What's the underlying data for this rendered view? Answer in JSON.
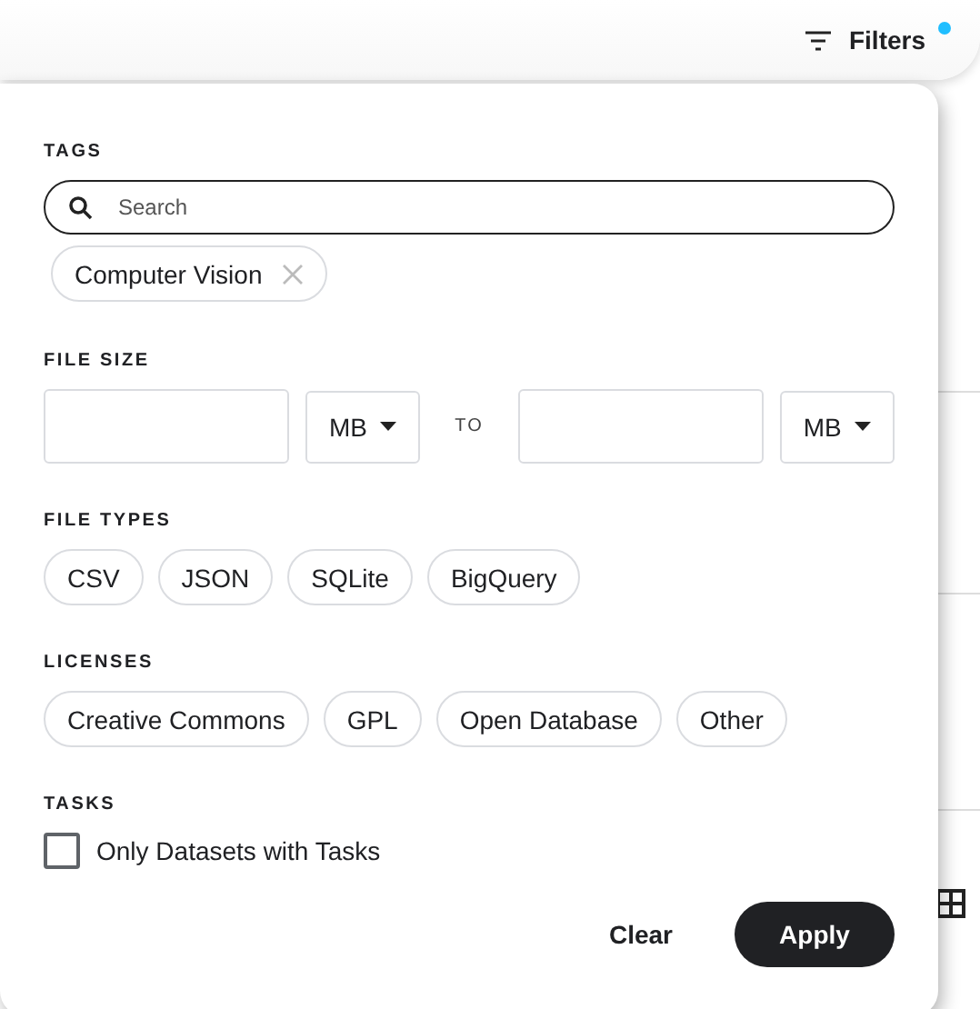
{
  "filters_button": {
    "label": "Filters",
    "active": true
  },
  "panel": {
    "tags": {
      "heading": "TAGS",
      "search": {
        "placeholder": "Search"
      },
      "chips": [
        {
          "label": "Computer Vision"
        }
      ]
    },
    "file_size": {
      "heading": "FILE SIZE",
      "min": {
        "unit": "MB"
      },
      "separator": "TO",
      "max": {
        "unit": "MB"
      }
    },
    "file_types": {
      "heading": "FILE TYPES",
      "options": [
        {
          "label": "CSV",
          "selected": false
        },
        {
          "label": "JSON",
          "selected": false
        },
        {
          "label": "SQLite",
          "selected": false
        },
        {
          "label": "BigQuery",
          "selected": false
        }
      ]
    },
    "licenses": {
      "heading": "LICENSES",
      "options": [
        {
          "label": "Creative Commons",
          "selected": false
        },
        {
          "label": "GPL",
          "selected": false
        },
        {
          "label": "Open Database",
          "selected": false
        },
        {
          "label": "Other",
          "selected": false
        }
      ]
    },
    "tasks": {
      "heading": "TASKS",
      "checkbox": {
        "label": "Only Datasets with Tasks",
        "checked": false
      }
    },
    "buttons": [
      {
        "label": "Clear",
        "kind": "text"
      },
      {
        "label": "Apply",
        "kind": "primary"
      }
    ]
  }
}
